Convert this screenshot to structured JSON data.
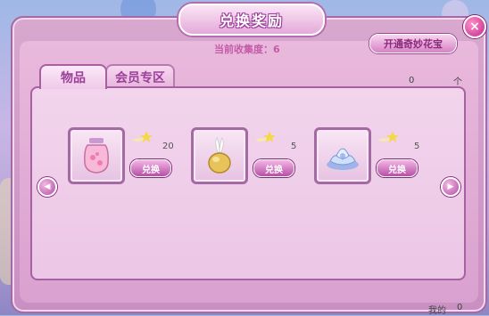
{
  "window": {
    "title": "兑换奖励",
    "close_glyph": "×"
  },
  "collection": {
    "text": "当前收集度：6"
  },
  "unlock_button": {
    "label": "开通奇妙花宝"
  },
  "tabs": [
    {
      "label": "物品",
      "active": true
    },
    {
      "label": "会员专区",
      "active": false
    }
  ],
  "items": [
    {
      "icon": "jar-icon",
      "count": "20",
      "exchange_label": "兑换"
    },
    {
      "icon": "onion-bulb-icon",
      "count": "5",
      "exchange_label": "兑换"
    },
    {
      "icon": "blue-flower-icon",
      "count": "5",
      "exchange_label": "兑换"
    }
  ],
  "background_texts": {
    "top_right_number": "0",
    "top_right_unit": "个",
    "bottom_right": "我的",
    "bottom_right_num": "0"
  },
  "nav": {
    "prev_glyph": "◀",
    "next_glyph": "▶"
  },
  "colors": {
    "accent": "#a860a5",
    "button": "#b650a6",
    "panel": "#f2d4ec"
  }
}
